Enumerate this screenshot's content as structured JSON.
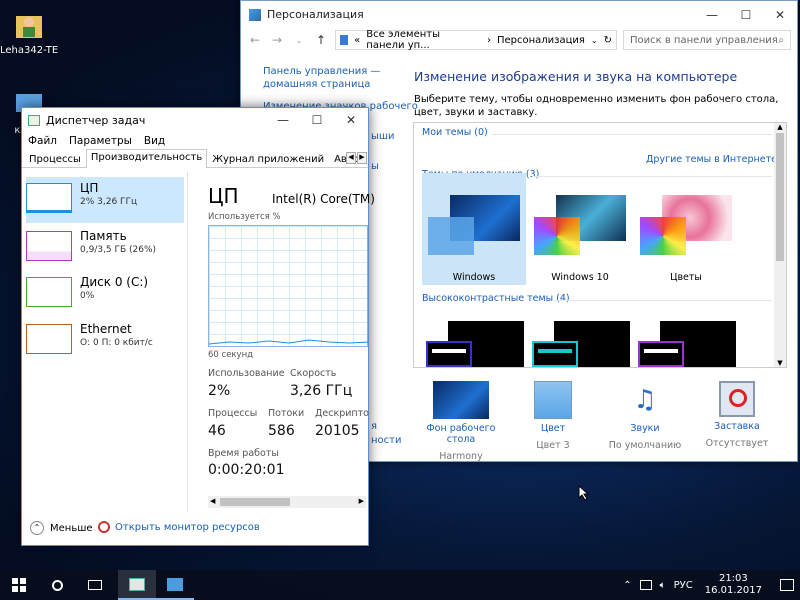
{
  "desktop": {
    "icons": [
      {
        "label": "Leha342-TE..."
      },
      {
        "label": "ком..."
      },
      {
        "label": "К..."
      }
    ]
  },
  "personalization": {
    "title": "Персонализация",
    "address_prefix": "«",
    "breadcrumb_1": "Все элементы панели уп...",
    "breadcrumb_sep": "›",
    "breadcrumb_2": "Персонализация",
    "search_placeholder": "Поиск в панели управления",
    "sidebar": {
      "home_link": "Панель управления —",
      "home_link2": "домашняя страница",
      "change_icons": "Изменение значков рабочего",
      "partial_1": "ыши",
      "partial_2": "ы",
      "partial_3": "я",
      "partial_4": "ности"
    },
    "heading": "Изменение изображения и звука на компьютере",
    "description": "Выберите тему, чтобы одновременно изменить фон рабочего стола, цвет, звуки и заставку.",
    "my_themes": "Мои темы (0)",
    "online_themes": "Другие темы в Интернете",
    "default_themes": "Темы по умолчанию (3)",
    "themes": [
      {
        "name": "Windows"
      },
      {
        "name": "Windows 10"
      },
      {
        "name": "Цветы"
      }
    ],
    "high_contrast": "Высококонтрастные темы (4)",
    "bottom": [
      {
        "label": "Фон рабочего стола",
        "value": "Harmony"
      },
      {
        "label": "Цвет",
        "value": "Цвет 3"
      },
      {
        "label": "Звуки",
        "value": "По умолчанию"
      },
      {
        "label": "Заставка",
        "value": "Отсутствует"
      }
    ]
  },
  "taskmanager": {
    "title": "Диспетчер задач",
    "menu": [
      "Файл",
      "Параметры",
      "Вид"
    ],
    "tabs": [
      "Процессы",
      "Производительность",
      "Журнал приложений",
      "Автозагрузка"
    ],
    "resources": [
      {
        "name": "ЦП",
        "detail": "2% 3,26 ГГц",
        "color": "#1f8fe0"
      },
      {
        "name": "Память",
        "detail": "0,9/3,5 ГБ (26%)",
        "color": "#a040c0"
      },
      {
        "name": "Диск 0 (C:)",
        "detail": "0%",
        "color": "#4aa830"
      },
      {
        "name": "Ethernet",
        "detail": "О: 0 П: 0 кбит/с",
        "color": "#b86020"
      }
    ],
    "detail_title": "ЦП",
    "cpu_model": "Intel(R) Core(TM)",
    "usage_label": "Используется %",
    "time_label": "60 секунд",
    "stats": {
      "usage_label": "Использование",
      "usage_value": "2%",
      "speed_label": "Скорость",
      "speed_value": "3,26 ГГц",
      "proc_label": "Процессы",
      "proc_value": "46",
      "threads_label": "Потоки",
      "threads_value": "586",
      "handles_label": "Дескрипторы",
      "handles_value": "20105",
      "uptime_label": "Время работы",
      "uptime_value": "0:00:20:01"
    },
    "less_label": "Меньше",
    "monitor_link": "Открыть монитор ресурсов"
  },
  "taskbar": {
    "lang": "РУС",
    "time": "21:03",
    "date": "16.01.2017"
  }
}
